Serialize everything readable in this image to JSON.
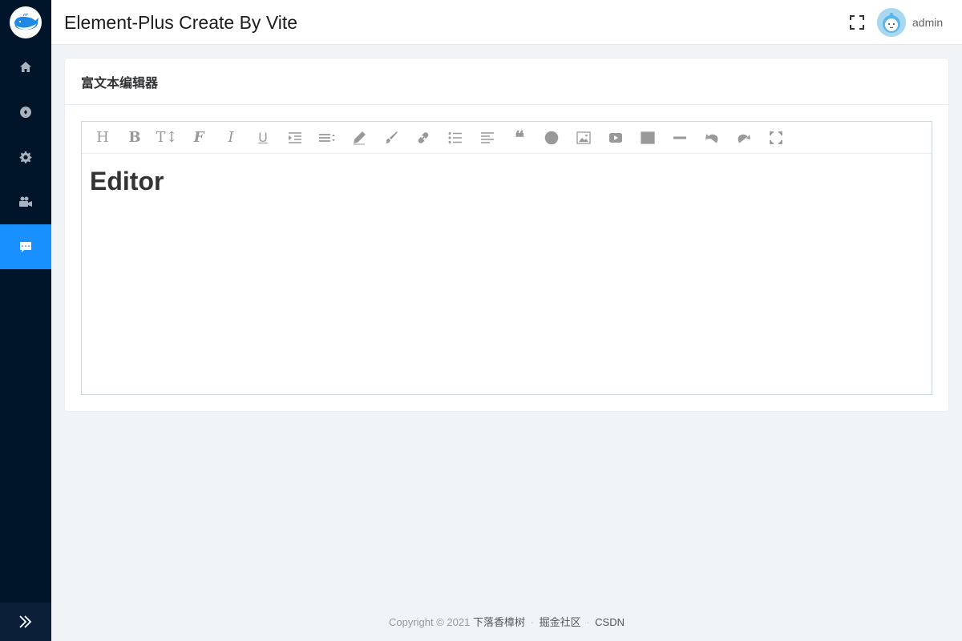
{
  "header": {
    "title": "Element-Plus Create By Vite",
    "username": "admin"
  },
  "sidebar": {
    "items": [
      {
        "icon": "home-icon",
        "active": false
      },
      {
        "icon": "compass-icon",
        "active": false
      },
      {
        "icon": "gear-icon",
        "active": false
      },
      {
        "icon": "video-camera-icon",
        "active": false
      },
      {
        "icon": "chat-icon",
        "active": true
      }
    ],
    "collapse_icon": "double-chevron-right-icon"
  },
  "card": {
    "title": "富文本编辑器"
  },
  "editor": {
    "toolbar": {
      "heading": "H",
      "bold": "B",
      "font_size": "T↕",
      "font_family": "F",
      "italic": "I",
      "underline": "U",
      "quote_glyph": "❝"
    },
    "content_heading": "Editor"
  },
  "footer": {
    "copyright": "Copyright © 2021",
    "link1": "下落香樟树",
    "separator": "·",
    "link2": "掘金社区",
    "link3": "CSDN"
  },
  "colors": {
    "sidebar_bg": "#001529",
    "active": "#1890ff",
    "page_bg": "#f0f4f7"
  }
}
